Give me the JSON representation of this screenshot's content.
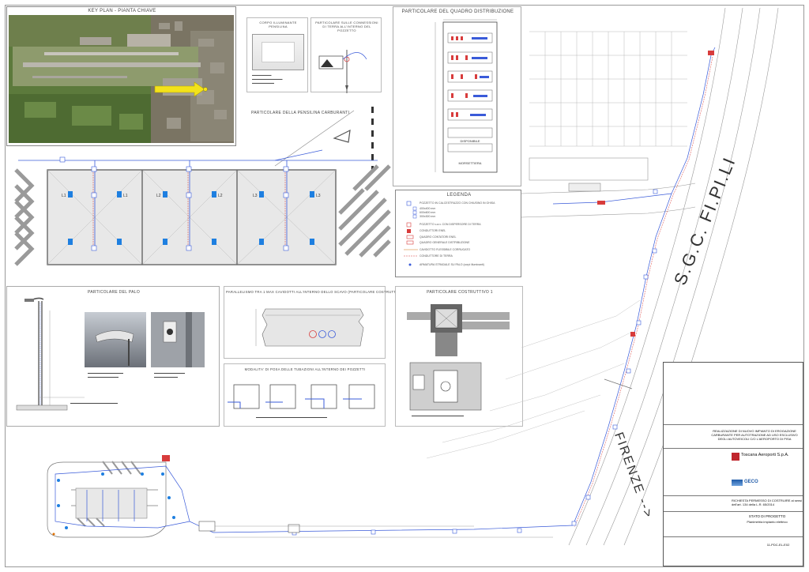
{
  "panels": {
    "key_plan_title": "KEY PLAN - PIANTA CHIAVE",
    "corpo_title": "CORPO ILLUMINANTE PENSILINA",
    "messa_terra_title": "PARTICOLARE SULLE CONNESSIONI DI TERRA ALL'INTERNO DEL POZZETTO",
    "quadro_title": "PARTICOLARE DEL QUADRO DISTRIBUZIONE",
    "pensilina_title": "PARTICOLARE DELLA PENSILINA CARBURANTI",
    "palo_title": "PARTICOLARE DEL PALO",
    "parallelismo_title": "PARALLELISMO TRA 1 MAX CAVIDOTTI ALL'INTERNO DELLO SCAVO (PARTICOLARE COSTRUTTIVO 2)",
    "modalita_title": "MODALITA' DI POSA DELLE TUBAZIONI ALL'INTERNO DEI POZZETTI",
    "costruttivo1_title": "PARTICOLARE COSTRUTTIVO 1",
    "legenda_title": "LEGENDA"
  },
  "quadro": {
    "row_disponibile": "DISPONIBILE",
    "row_morsettiera": "MORSETTIERA"
  },
  "legenda_items": [
    "POZZETTO IN CALCESTRUZZO CON CHIUSINO IN GHISA",
    "400x400 mm",
    "600x600 mm",
    "300x300 mm",
    "POZZETTO c.a.v. CON DISPERSORE DI TERRA",
    "CONDUTTORI ENEL",
    "QUADRO CONTATORI ENEL",
    "QUADRO GENERALE DISTRIBUZIONE",
    "CAVIDOTTO FLESSIBILE CORRUGATO",
    "CONDUTTORE DI TERRA",
    "ARMATURA STRADALE SU PALO (corpi illuminanti)"
  ],
  "pensilina_lamps": [
    "L1",
    "L1",
    "L2",
    "L2",
    "L3",
    "L3"
  ],
  "roads": {
    "sgc": "S.G.C. FI.PI.LI",
    "firenze": "FIRENZE -->"
  },
  "title_block": {
    "subject": "REALIZZAZIONE DI NUOVO IMPIANTO DI EROGAZIONE CARBURANTE PER AUTOTRAZIONE AD USO ESCLUSIVO DEGLI AUTOVEICOLI C/O L'AEROPORTO DI PISA",
    "client": "Toscana Aeroporti S.p.A.",
    "designer": "GECO",
    "request": "RICHIESTA PERMESSO DI COSTRUIRE ai sensi dell'art. 134 della L.R. 65/2014",
    "state": "STATO DI PROGETTO",
    "drawing": "Planimetria impianto elettrico",
    "code": "11-PDC-EL-E02"
  },
  "colors": {
    "cable": "#3a5bd9",
    "earth": "#d83c3c",
    "grass": "#5f7f3e",
    "lamp": "#1e7fe0",
    "hatch": "#777777"
  }
}
